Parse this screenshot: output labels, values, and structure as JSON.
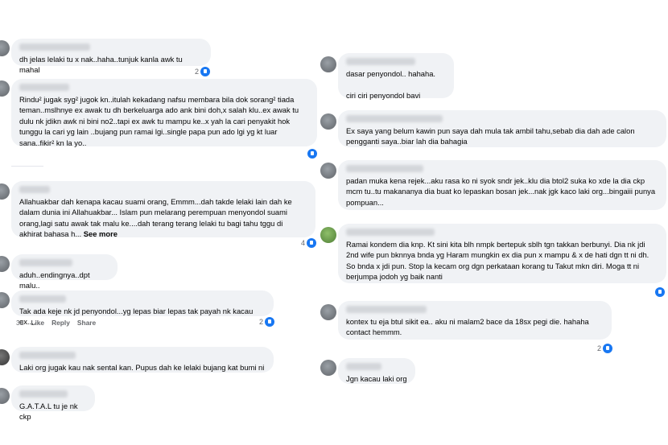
{
  "left_comments": [
    {
      "text": "dh jelas lelaki tu x nak..haha..tunjuk kanla awk tu mahal",
      "reactions": "2"
    },
    {
      "text": "Rindu² jugak syg² jugok kn..itulah kekadang nafsu membara bila dok sorang² tiada teman..mslhnye ex awak tu dh berkeluarga ado ank bini doh,x salah klu..ex awak tu dulu nk jdikn awk ni bini no2..tapi ex awk tu mampu ke..x yah la cari penyakit hok tunggu la cari yg lain ..bujang pun ramai lgi..single papa pun ado lgi yg kt luar sana..fikir² kn la yo.."
    },
    {
      "text": "Allahuakbar dah kenapa kacau suami orang, Emmm...dah takde lelaki lain dah ke dalam dunia ini Allahuakbar... Islam pun melarang perempuan menyondol suami orang,lagi satu awak tak malu ke....dah terang terang lelaki tu bagi tahu tggu di akhirat bahasa h...",
      "see_more": "See more",
      "reactions": "4"
    },
    {
      "text": "aduh..endingnya..dpt malu.."
    },
    {
      "text": "Tak ada keje nk jd penyondol...yg lepas biar lepas tak payah nk kacau ex....",
      "reactions": "2",
      "actions": {
        "time": "3d",
        "like": "Like",
        "reply": "Reply",
        "share": "Share"
      }
    },
    {
      "text": "Laki org jugak kau nak sental kan. Pupus dah ke lelaki bujang kat bumi ni"
    },
    {
      "text": "G.A.T.A.L tu je nk ckp"
    }
  ],
  "right_comments": [
    {
      "text": "dasar penyondol.. hahaha.\n\nciri ciri penyondol bavi"
    },
    {
      "text": "Ex saya yang belum kawin pun saya dah mula tak ambil tahu,sebab dia dah ade calon pengganti saya..biar lah dia bahagia"
    },
    {
      "text": "padan muka kena rejek...aku rasa ko ni syok sndr jek..klu dia btol2 suka ko xde la dia ckp mcm tu..tu makananya dia buat ko lepaskan bosan jek...nak jgk kaco laki org...bingaiii punya pompuan..."
    },
    {
      "text": "Ramai kondem dia knp. Kt sini kita blh nmpk bertepuk sblh tgn takkan berbunyi. Dia nk jdi 2nd wife pun bknnya bnda yg Haram mungkin ex dia pun x mampu & x de hati dgn tt ni dh. So bnda x jdi pun. Stop la kecam org dgn perkataan korang tu Takut mkn diri. Moga tt ni berjumpa jodoh yg baik nanti"
    },
    {
      "text": "kontex tu eja btul sikit ea.. aku ni malam2 bace da 18sx pegi die. hahaha contact hemmm.",
      "reactions": "2"
    },
    {
      "text": "Jgn kacau laki org"
    }
  ]
}
